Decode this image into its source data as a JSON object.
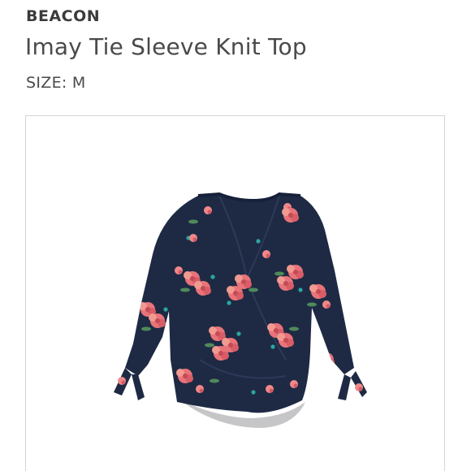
{
  "product": {
    "brand": "BEACON",
    "name": "Imay Tie Sleeve Knit Top",
    "size": "SIZE: M"
  },
  "image": {
    "icon": "floral-wrap-top-photo"
  },
  "colors": {
    "navy": "#1e2a44",
    "pink": "#e8747a",
    "teal": "#2aa7a0",
    "border": "#d4d4d4",
    "text": "#3b3b3b"
  }
}
